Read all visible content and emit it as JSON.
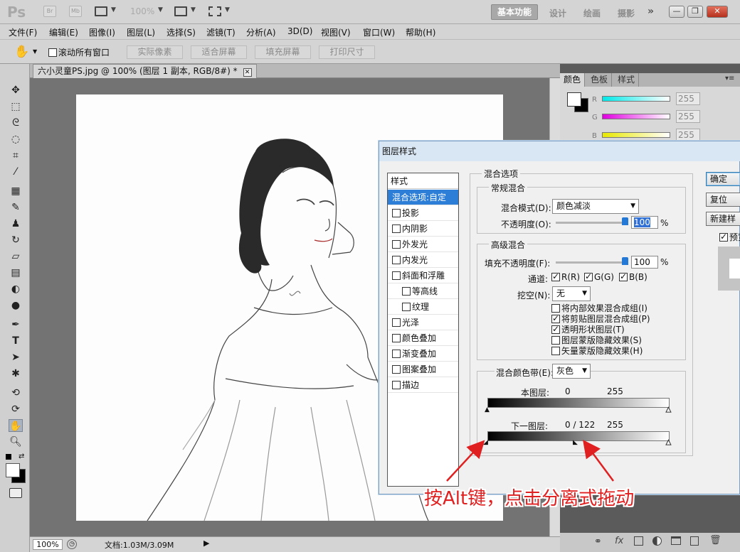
{
  "app": {
    "logo": "Ps",
    "bridge_label": "Br",
    "minibridge_label": "Mb",
    "zoom_display": "100%",
    "workspaces": [
      "基本功能",
      "设计",
      "绘画",
      "摄影"
    ],
    "more": "»",
    "window_buttons": [
      "—",
      "❐",
      "✕"
    ]
  },
  "menubar": {
    "items": [
      "文件(F)",
      "编辑(E)",
      "图像(I)",
      "图层(L)",
      "选择(S)",
      "滤镜(T)",
      "分析(A)",
      "3D(D)",
      "视图(V)",
      "窗口(W)",
      "帮助(H)"
    ]
  },
  "options": {
    "scroll_all": "滚动所有窗口",
    "buttons": [
      "实际像素",
      "适合屏幕",
      "填充屏幕",
      "打印尺寸"
    ]
  },
  "document": {
    "tab_title": "六小灵童PS.jpg @ 100% (图层 1 副本, RGB/8#) *",
    "zoom": "100%",
    "doc_info": "文档:1.03M/3.09M"
  },
  "color_panel": {
    "tabs": [
      "颜色",
      "色板",
      "样式"
    ],
    "channels": [
      {
        "label": "R",
        "value": "255",
        "color": "#00d8d8"
      },
      {
        "label": "G",
        "value": "255",
        "color": "#e000e0"
      },
      {
        "label": "B",
        "value": "255",
        "color": "#e8e800"
      }
    ]
  },
  "dialog": {
    "title": "图层样式",
    "styles_header": "样式",
    "style_items": [
      {
        "label": "混合选项:自定",
        "checkbox": false,
        "selected": true,
        "indent": false
      },
      {
        "label": "投影",
        "checkbox": true,
        "indent": false
      },
      {
        "label": "内阴影",
        "checkbox": true,
        "indent": false
      },
      {
        "label": "外发光",
        "checkbox": true,
        "indent": false
      },
      {
        "label": "内发光",
        "checkbox": true,
        "indent": false
      },
      {
        "label": "斜面和浮雕",
        "checkbox": true,
        "indent": false
      },
      {
        "label": "等高线",
        "checkbox": true,
        "indent": true
      },
      {
        "label": "纹理",
        "checkbox": true,
        "indent": true
      },
      {
        "label": "光泽",
        "checkbox": true,
        "indent": false
      },
      {
        "label": "颜色叠加",
        "checkbox": true,
        "indent": false
      },
      {
        "label": "渐变叠加",
        "checkbox": true,
        "indent": false
      },
      {
        "label": "图案叠加",
        "checkbox": true,
        "indent": false
      },
      {
        "label": "描边",
        "checkbox": true,
        "indent": false
      }
    ],
    "blend_options_title": "混合选项",
    "general_title": "常规混合",
    "blend_mode_label": "混合模式(D):",
    "blend_mode_value": "颜色减淡",
    "opacity_label": "不透明度(O):",
    "opacity_value": "100",
    "percent": "%",
    "advanced_title": "高级混合",
    "fill_opacity_label": "填充不透明度(F):",
    "fill_opacity_value": "100",
    "channels_label": "通道:",
    "channel_r": "R(R)",
    "channel_g": "G(G)",
    "channel_b": "B(B)",
    "knockout_label": "挖空(N):",
    "knockout_value": "无",
    "options": [
      {
        "label": "将内部效果混合成组(I)",
        "checked": false
      },
      {
        "label": "将剪贴图层混合成组(P)",
        "checked": true
      },
      {
        "label": "透明形状图层(T)",
        "checked": true
      },
      {
        "label": "图层蒙版隐藏效果(S)",
        "checked": false
      },
      {
        "label": "矢量蒙版隐藏效果(H)",
        "checked": false
      }
    ],
    "blend_if_label": "混合颜色带(E):",
    "blend_if_value": "灰色",
    "this_layer_label": "本图层:",
    "this_layer_low": "0",
    "this_layer_high": "255",
    "underlying_label": "下一图层:",
    "underlying_values": "0  /  122",
    "underlying_high": "255",
    "btn_ok": "确定",
    "btn_reset": "复位",
    "btn_new_style": "新建样式...",
    "preview_label": "预览"
  },
  "annotation": "按Alt键，点击分离式拖动"
}
